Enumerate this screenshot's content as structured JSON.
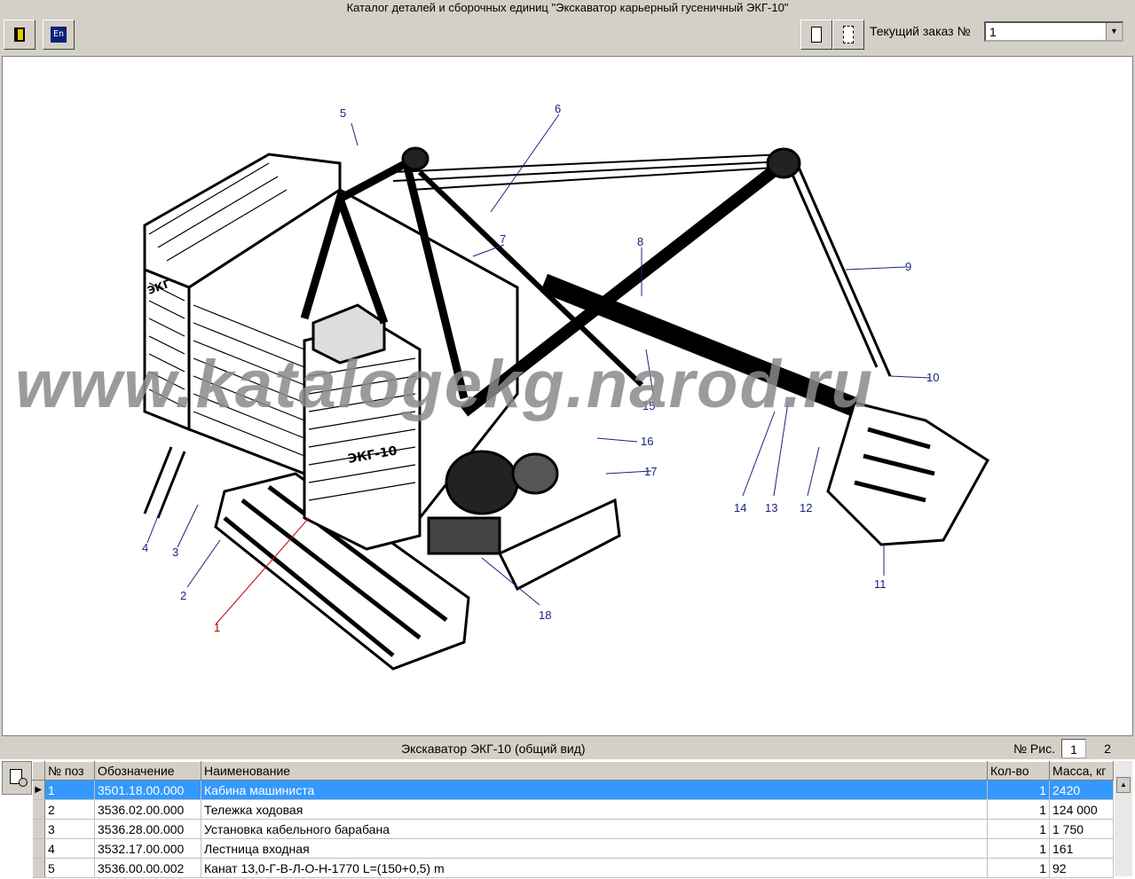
{
  "window_title": "Каталог деталей и сборочных единиц \"Экскаватор карьерный гусеничный ЭКГ-10\"",
  "toolbar": {
    "exit_icon": "exit-door-icon",
    "lang_icon": "english-language-icon",
    "lang_text": "En",
    "page_icon": "single-page-icon",
    "pages_icon": "multi-page-icon",
    "order_label": "Текущий заказ №",
    "order_value": "1"
  },
  "drawing": {
    "watermark": "www.katalogekg.narod.ru",
    "callouts": [
      "1",
      "2",
      "3",
      "4",
      "5",
      "6",
      "7",
      "8",
      "9",
      "10",
      "11",
      "12",
      "13",
      "14",
      "15",
      "16",
      "17",
      "18"
    ],
    "cab_mark": "ЭКГ-10",
    "cab_mark_left": "ЭКГ"
  },
  "caption": {
    "title": "Экскаватор ЭКГ-10 (общий вид)",
    "fig_label": "№ Рис.",
    "fig_current": "1",
    "fig_other": "2"
  },
  "grid": {
    "columns": [
      "№ поз",
      "Обозначение",
      "Наименование",
      "Кол-во",
      "Масса, кг"
    ],
    "rows": [
      {
        "pos": "1",
        "code": "3501.18.00.000",
        "name": "Кабина машиниста",
        "qty": "1",
        "mass": "2420"
      },
      {
        "pos": "2",
        "code": "3536.02.00.000",
        "name": "Тележка ходовая",
        "qty": "1",
        "mass": "124 000"
      },
      {
        "pos": "3",
        "code": "3536.28.00.000",
        "name": "Установка кабельного барабана",
        "qty": "1",
        "mass": "1 750"
      },
      {
        "pos": "4",
        "code": "3532.17.00.000",
        "name": "Лестница входная",
        "qty": "1",
        "mass": "161"
      },
      {
        "pos": "5",
        "code": "3536.00.00.002",
        "name": "Канат 13,0-Г-В-Л-О-Н-1770 L=(150+0,5) m",
        "qty": "1",
        "mass": "92"
      }
    ],
    "selected_marker": "▶"
  }
}
